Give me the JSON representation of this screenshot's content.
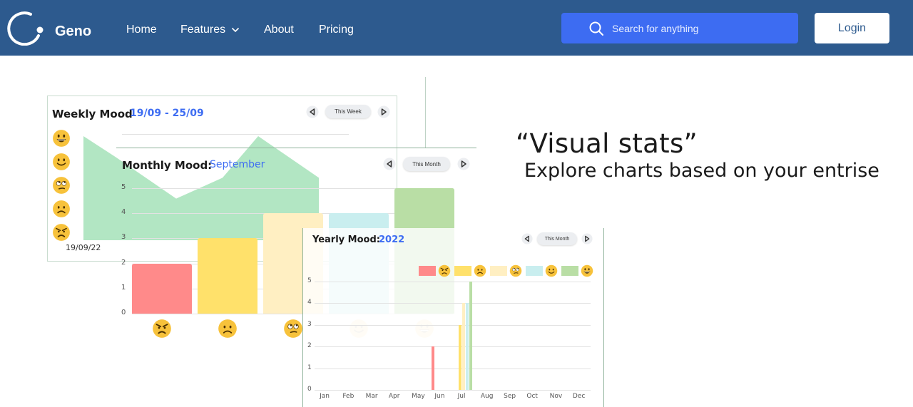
{
  "nav": {
    "brand": "Geno",
    "links": [
      "Home",
      "Features",
      "About",
      "Pricing"
    ],
    "search_placeholder": "Search for anything",
    "login_label": "Login",
    "bg_color": "#2d5a8e",
    "search_color": "#3d6cf2"
  },
  "hero": {
    "title": "“Visual stats”",
    "subtitle": "Explore charts based on your entrise"
  },
  "weekly": {
    "title": "Weekly Mood",
    "range": "19/09 - 25/09",
    "period_label": "This Week",
    "x_label": "19/09/22",
    "mood_icons": [
      "grinning-face",
      "smiling-face",
      "eye-roll-face",
      "frowning-face",
      "angry-face"
    ]
  },
  "monthly": {
    "title": "Monthly Mood:",
    "month": "September",
    "period_label": "This Month"
  },
  "yearly": {
    "title": "Yearly Mood:",
    "year": "2022",
    "period_label": "This Month"
  },
  "chart_data": [
    {
      "type": "area",
      "title": "Weekly Mood",
      "categories": [
        "19/09/22"
      ],
      "series": [
        {
          "values": [
            5,
            4,
            2,
            3,
            5,
            3
          ]
        }
      ],
      "colors": [
        "#a5e2b8"
      ]
    },
    {
      "type": "bar",
      "title": "Monthly Mood: September",
      "categories": [
        "angry",
        "sad",
        "meh",
        "happy",
        "very happy"
      ],
      "values": [
        2,
        3,
        4,
        4,
        5
      ],
      "ylim": [
        0,
        5
      ],
      "yticks": [
        "0",
        "1",
        "2",
        "3",
        "4",
        "5"
      ],
      "colors": [
        "#ff8a8a",
        "#ffe16b",
        "#ffefc2",
        "#c9eeef",
        "#b9dea5"
      ]
    },
    {
      "type": "bar",
      "title": "Yearly Mood: 2022",
      "categories": [
        "Jan",
        "Feb",
        "Mar",
        "Apr",
        "May",
        "Jun",
        "Jul",
        "Aug",
        "Sep",
        "Oct",
        "Nov",
        "Dec"
      ],
      "series": [
        {
          "values": [
            0,
            0,
            0,
            0,
            0,
            2,
            0,
            0,
            0,
            0,
            0,
            0
          ]
        },
        {
          "values": [
            0,
            0,
            0,
            0,
            0,
            0,
            3,
            0,
            0,
            0,
            0,
            0
          ]
        },
        {
          "values": [
            0,
            0,
            0,
            0,
            0,
            0,
            4,
            0,
            0,
            0,
            0,
            0
          ]
        },
        {
          "values": [
            0,
            0,
            0,
            0,
            0,
            0,
            4,
            0,
            0,
            0,
            0,
            0
          ]
        },
        {
          "values": [
            0,
            0,
            0,
            0,
            0,
            0,
            5,
            0,
            0,
            0,
            0,
            0
          ]
        }
      ],
      "ylim": [
        0,
        5
      ],
      "yticks": [
        "0",
        "1",
        "2",
        "3",
        "4",
        "5"
      ],
      "legend": "top-right",
      "colors": [
        "#ff8a8a",
        "#ffe16b",
        "#ffefc2",
        "#c9eeef",
        "#b9dea5"
      ]
    }
  ]
}
